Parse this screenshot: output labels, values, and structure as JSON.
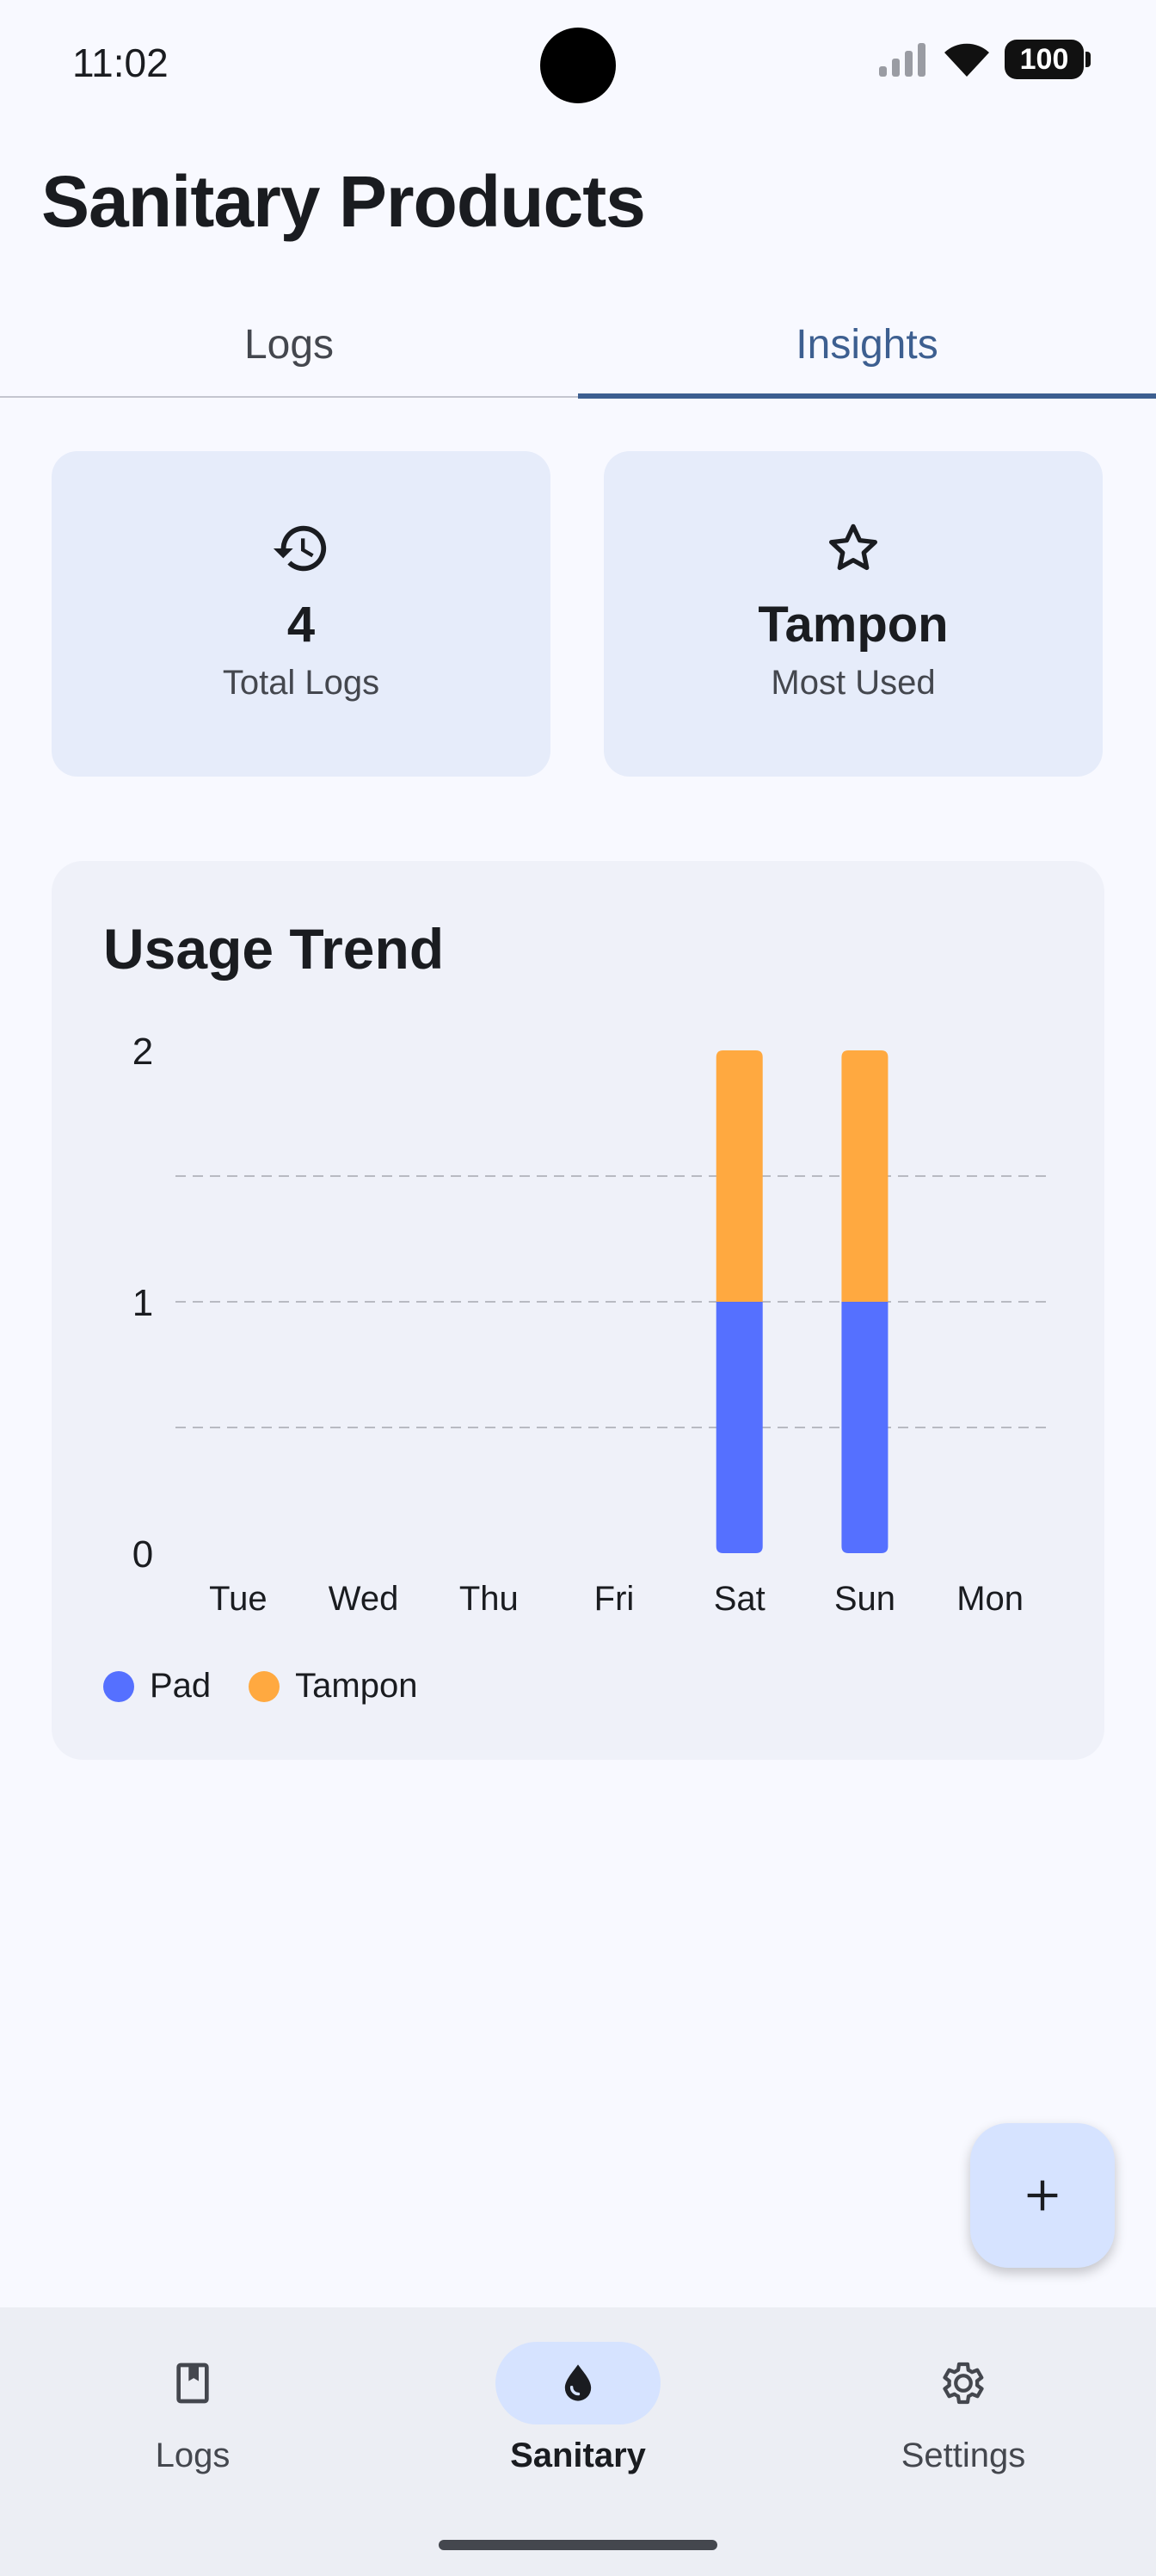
{
  "status_bar": {
    "time": "11:02",
    "battery": "100"
  },
  "header": {
    "title": "Sanitary Products"
  },
  "tabs": [
    {
      "label": "Logs",
      "active": false
    },
    {
      "label": "Insights",
      "active": true
    }
  ],
  "stats": {
    "total": {
      "value": "4",
      "label": "Total Logs",
      "icon": "history-icon"
    },
    "most_used": {
      "value": "Tampon",
      "label": "Most Used",
      "icon": "star-icon"
    }
  },
  "chart_card": {
    "title": "Usage Trend"
  },
  "chart_data": {
    "type": "bar",
    "stacked": true,
    "categories": [
      "Tue",
      "Wed",
      "Thu",
      "Fri",
      "Sat",
      "Sun",
      "Mon"
    ],
    "series": [
      {
        "name": "Pad",
        "color": "#5570ff",
        "values": [
          0,
          0,
          0,
          0,
          1,
          1,
          0
        ]
      },
      {
        "name": "Tampon",
        "color": "#ffa940",
        "values": [
          0,
          0,
          0,
          0,
          1,
          1,
          0
        ]
      }
    ],
    "y_ticks": [
      "0",
      "1",
      "2"
    ],
    "ylim": [
      0,
      2
    ],
    "grid": true,
    "legend": "bottom-left"
  },
  "fab": {
    "icon": "plus-icon"
  },
  "bottom_nav": [
    {
      "label": "Logs",
      "icon": "book-icon",
      "active": false
    },
    {
      "label": "Sanitary",
      "icon": "drop-icon",
      "active": true
    },
    {
      "label": "Settings",
      "icon": "gear-icon",
      "active": false
    }
  ]
}
